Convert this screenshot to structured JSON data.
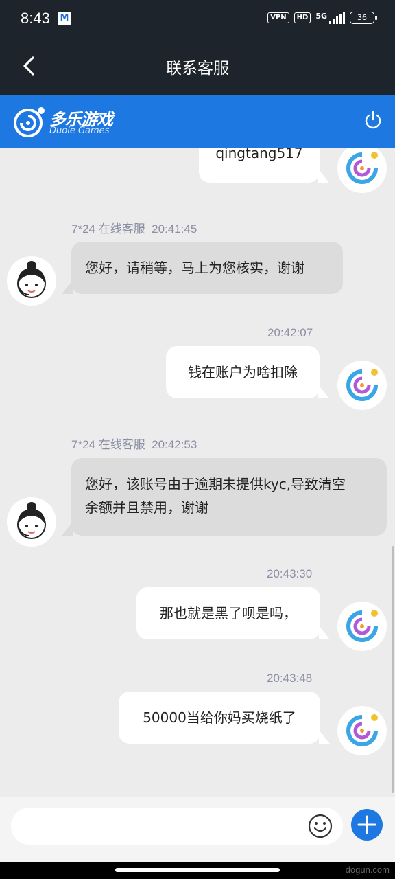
{
  "status_bar": {
    "time": "8:43",
    "notification_icon": "mail-notification-icon",
    "vpn": "VPN",
    "hd": "HD",
    "network": "5G",
    "battery": "36"
  },
  "nav": {
    "title": "联系客服",
    "back_icon": "back-arrow-icon"
  },
  "brand": {
    "name_cn": "多乐游戏",
    "name_en": "Duole Games",
    "accent": "#1e78e2",
    "power_icon": "power-icon"
  },
  "messages": [
    {
      "side": "out",
      "time": "",
      "text": "qingtang517",
      "partial": true
    },
    {
      "side": "in",
      "sender": "7*24 在线客服",
      "time": "20:41:45",
      "lines": [
        "您好，请稍等，马上为您核实，谢谢"
      ]
    },
    {
      "side": "out",
      "time": "20:42:07",
      "lines": [
        "钱在账户为啥扣除"
      ]
    },
    {
      "side": "in",
      "sender": "7*24 在线客服",
      "time": "20:42:53",
      "lines": [
        "您好，该账号由于逾期未提供kyc,导致清空",
        "余额并且禁用，谢谢"
      ]
    },
    {
      "side": "out",
      "time": "20:43:30",
      "lines": [
        "那也就是黑了呗是吗，"
      ]
    },
    {
      "side": "out",
      "time": "20:43:48",
      "lines": [
        "50000当给你妈买烧纸了"
      ]
    }
  ],
  "composer": {
    "placeholder": "",
    "emoji_icon": "emoji-icon",
    "add_icon": "plus-icon"
  },
  "watermark": "dogun.com"
}
